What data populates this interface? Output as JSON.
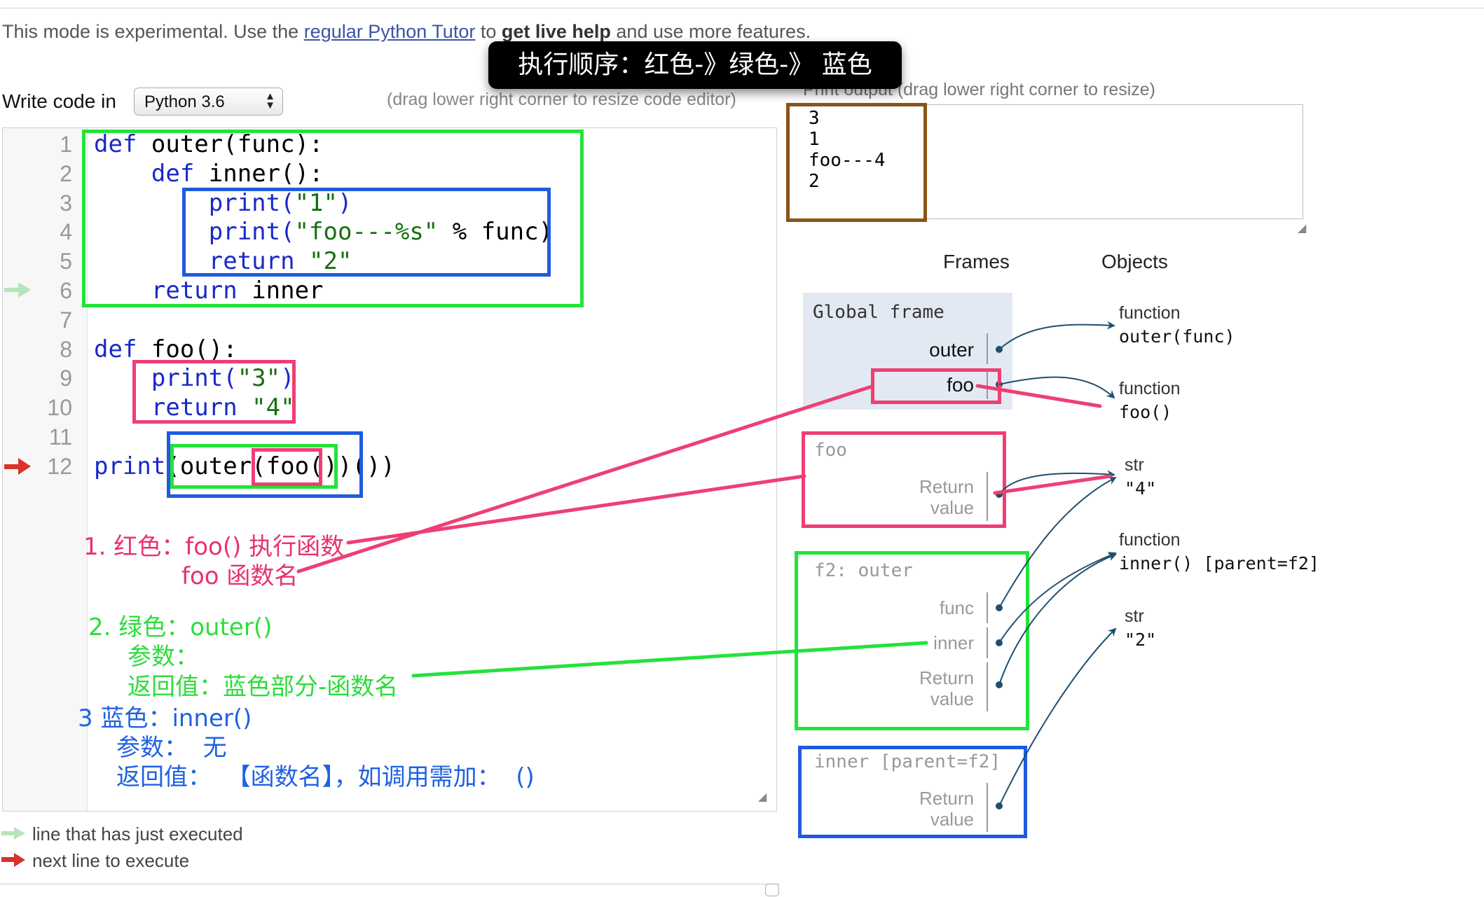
{
  "notice": {
    "prefix": "This mode is experimental. Use the ",
    "link": "regular Python Tutor",
    "middle": " to ",
    "bold": "get live help",
    "suffix": " and use more features."
  },
  "tooltip": "执行顺序：红色-》绿色-》 蓝色",
  "editor_toolbar": {
    "label": "Write code in",
    "language": "Python 3.6",
    "resize_hint": "(drag lower right corner to resize code editor)"
  },
  "code_lines": [
    {
      "n": "1",
      "tokens": [
        {
          "t": "def",
          "c": "kw"
        },
        {
          "t": " outer(func):",
          "c": ""
        }
      ]
    },
    {
      "n": "2",
      "tokens": [
        {
          "t": "    ",
          "c": ""
        },
        {
          "t": "def",
          "c": "kw"
        },
        {
          "t": " inner():",
          "c": ""
        }
      ]
    },
    {
      "n": "3",
      "tokens": [
        {
          "t": "        print(",
          "c": "kw"
        },
        {
          "t": "\"1\"",
          "c": "st"
        },
        {
          "t": ")",
          "c": "kw"
        }
      ]
    },
    {
      "n": "4",
      "tokens": [
        {
          "t": "        print(",
          "c": "kw"
        },
        {
          "t": "\"foo---%s\"",
          "c": "st"
        },
        {
          "t": " % func)",
          "c": ""
        }
      ]
    },
    {
      "n": "5",
      "tokens": [
        {
          "t": "        return",
          "c": "kw"
        },
        {
          "t": " \"2\"",
          "c": "st"
        }
      ]
    },
    {
      "n": "6",
      "tokens": [
        {
          "t": "    return",
          "c": "kw"
        },
        {
          "t": " inner",
          "c": ""
        }
      ]
    },
    {
      "n": "7",
      "tokens": []
    },
    {
      "n": "8",
      "tokens": [
        {
          "t": "def",
          "c": "kw"
        },
        {
          "t": " foo():",
          "c": ""
        }
      ]
    },
    {
      "n": "9",
      "tokens": [
        {
          "t": "    print(",
          "c": "kw"
        },
        {
          "t": "\"3\"",
          "c": "st"
        },
        {
          "t": ")",
          "c": "kw"
        }
      ]
    },
    {
      "n": "10",
      "tokens": [
        {
          "t": "    return",
          "c": "kw"
        },
        {
          "t": " \"4\"",
          "c": "st"
        }
      ]
    },
    {
      "n": "11",
      "tokens": []
    },
    {
      "n": "12",
      "tokens": [
        {
          "t": "print",
          "c": "kw"
        },
        {
          "t": "(outer(foo())())",
          "c": ""
        }
      ]
    }
  ],
  "notes": {
    "red_1": "1. 红色：foo() 执行函数",
    "red_2": "foo 函数名",
    "green_1": "2. 绿色：outer()",
    "green_2": "参数：",
    "green_3": "返回值：蓝色部分-函数名",
    "blue_1": "3 蓝色：inner()",
    "blue_2": "参数：  无",
    "blue_3": "返回值：  【函数名】，如调用需加：  ()"
  },
  "legend": {
    "just_executed": "line that has just executed",
    "next_line": "next line to execute"
  },
  "print_output": {
    "header": "Print output",
    "resize_hint": "(drag lower right corner to resize)",
    "lines": [
      "3",
      "1",
      "foo---4",
      "2"
    ]
  },
  "viz": {
    "frames_header": "Frames",
    "objects_header": "Objects",
    "global_frame": {
      "title": "Global frame",
      "vars": [
        "outer",
        "foo"
      ]
    },
    "frame_foo": {
      "title": "foo",
      "return_1": "Return",
      "return_2": "value"
    },
    "frame_f2": {
      "title": "f2: outer",
      "var_func": "func",
      "var_inner": "inner",
      "return_1": "Return",
      "return_2": "value"
    },
    "frame_inner": {
      "title": "inner [parent=f2]",
      "return_1": "Return",
      "return_2": "value"
    },
    "objects": [
      {
        "type": "function",
        "value": "outer(func)"
      },
      {
        "type": "function",
        "value": "foo()"
      },
      {
        "type": "str",
        "value": "\"4\""
      },
      {
        "type": "function",
        "value": "inner()  [parent=f2]"
      },
      {
        "type": "str",
        "value": "\"2\""
      }
    ]
  },
  "colors": {
    "annotation_red": "#ee3f73",
    "annotation_green": "#23e33a",
    "annotation_blue": "#1f5be0",
    "annotation_brown": "#8a5418",
    "keyword": "#1a29c7",
    "string": "#16710f",
    "arrow_just_executed": "#b7e4b9",
    "arrow_next": "#d9332b",
    "pointer": "#1f4f6f"
  }
}
